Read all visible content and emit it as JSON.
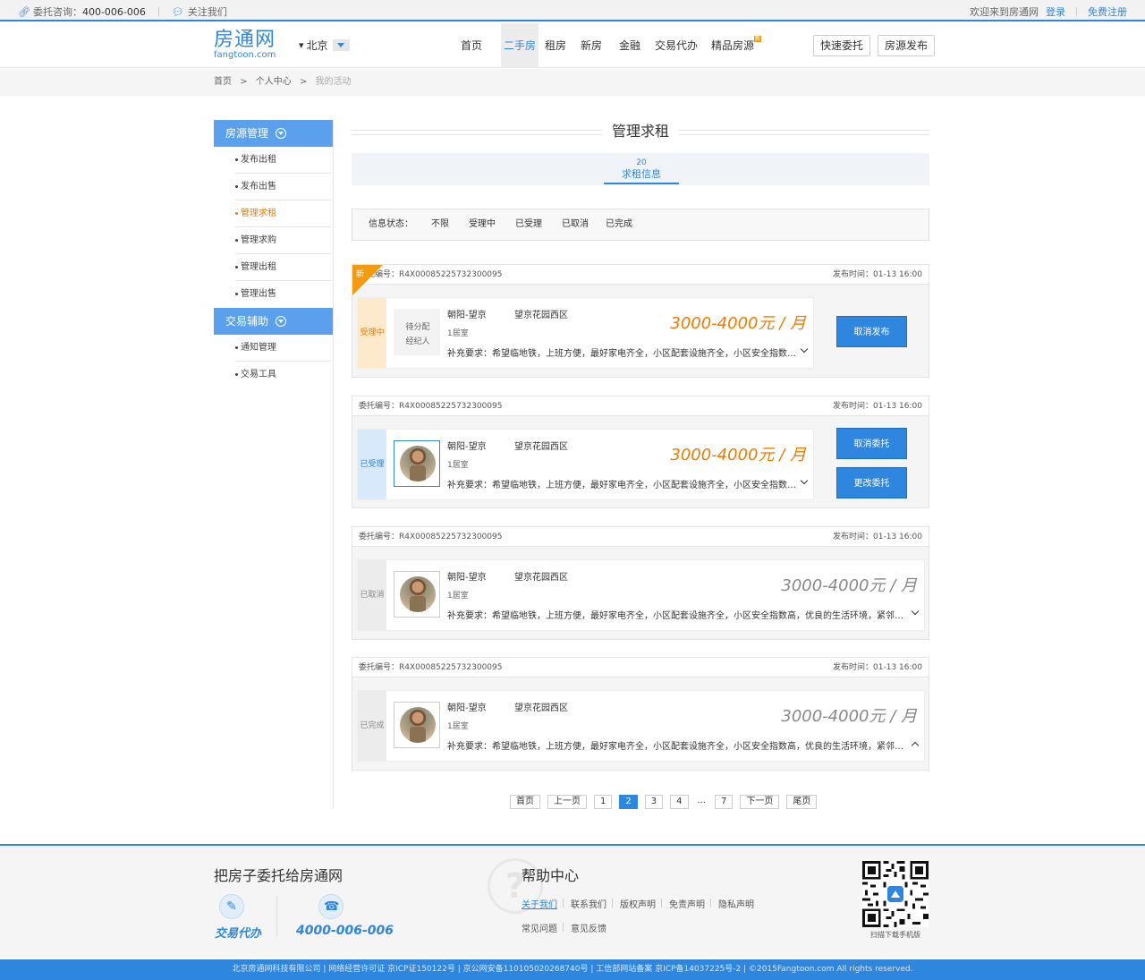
{
  "topbar": {
    "consult_label": "委托咨询：",
    "consult_phone": "400-006-006",
    "follow_label": "关注我们",
    "welcome": "欢迎来到房通网",
    "login": "登录",
    "register": "免费注册"
  },
  "header": {
    "logo_main": "房通网",
    "logo_sub": "fangtoon.com",
    "city": "北京",
    "nav": [
      "首页",
      "二手房",
      "租房",
      "新房",
      "金融",
      "交易代办",
      "精品房源"
    ],
    "nav_badge": "新",
    "active_nav": "二手房",
    "btn_quick": "快速委托",
    "btn_publish": "房源发布"
  },
  "breadcrumb": {
    "home": "首页",
    "center": "个人中心",
    "current": "我的活动",
    "sep": ">"
  },
  "sidebar": {
    "group1": "房源管理",
    "group1_items": [
      "发布出租",
      "发布出售",
      "管理求租",
      "管理求购",
      "管理出租",
      "管理出售"
    ],
    "group2": "交易辅助",
    "group2_items": [
      "通知管理",
      "交易工具"
    ],
    "active": "管理求租"
  },
  "main": {
    "title": "管理求租",
    "tab_count": "20",
    "tab_label": "求租信息",
    "filter_label": "信息状态：",
    "filters": [
      "不限",
      "受理中",
      "已受理",
      "已取消",
      "已完成"
    ]
  },
  "cards": [
    {
      "ribbon": "新",
      "code": "委托编号：R4X00085225732300095",
      "time": "发布时间：01-13 16:00",
      "status": "受理中",
      "agent_line1": "待分配",
      "agent_line2": "经纪人",
      "location": "朝阳-望京",
      "community": "望京花园西区",
      "rooms": "1居室",
      "desc": "补充要求：希望临地铁，上班方便，最好家电齐全，小区配套设施齐全，小区安全指数高，优...",
      "price": "3000-4000元 / 月",
      "buttons": [
        "取消发布"
      ]
    },
    {
      "code": "委托编号：R4X00085225732300095",
      "time": "发布时间：01-13 16:00",
      "status": "已受理",
      "location": "朝阳-望京",
      "community": "望京花园西区",
      "rooms": "1居室",
      "desc": "补充要求：希望临地铁，上班方便，最好家电齐全，小区配套设施齐全，小区安全指数高，优...",
      "price": "3000-4000元 / 月",
      "buttons": [
        "取消委托",
        "更改委托"
      ]
    },
    {
      "code": "委托编号：R4X00085225732300095",
      "time": "发布时间：01-13 16:00",
      "status": "已取消",
      "location": "朝阳-望京",
      "community": "望京花园西区",
      "rooms": "1居室",
      "desc": "补充要求：希望临地铁，上班方便，最好家电齐全，小区配套设施齐全，小区安全指数高，优良的生活环境，紧邻商业区，...",
      "price": "3000-4000元 / 月",
      "buttons": []
    },
    {
      "code": "委托编号：R4X00085225732300095",
      "time": "发布时间：01-13 16:00",
      "status": "已完成",
      "location": "朝阳-望京",
      "community": "望京花园西区",
      "rooms": "1居室",
      "desc": "补充要求：希望临地铁，上班方便，最好家电齐全，小区配套设施齐全，小区安全指数高，优良的生活环境，紧邻商业区，...",
      "price": "3000-4000元 / 月",
      "buttons": []
    }
  ],
  "pager": {
    "first": "首页",
    "prev": "上一页",
    "pages": [
      "1",
      "2",
      "3",
      "4",
      "...",
      "7"
    ],
    "current": "2",
    "next": "下一页",
    "last": "尾页"
  },
  "footer": {
    "slogan": "把房子委托给房通网",
    "service": "交易代办",
    "phone": "4000-006-006",
    "help_title": "帮助中心",
    "links_row1": [
      "关于我们",
      "联系我们",
      "版权声明",
      "免责声明",
      "隐私声明"
    ],
    "links_row2": [
      "常见问题",
      "意见反馈"
    ],
    "qr_caption": "扫描下载手机版",
    "copyright": "北京房通网科技有限公司 | 网络经营许可证 京ICP证150122号 | 京公网安备110105020268740号 | 工信部网站备案 京ICP备14037225号-2 | ©2015Fangtoon.com All rights reserved."
  },
  "colors": {
    "brand": "#2e86de",
    "accent": "#ee7a00",
    "ribbon": "#f29b12"
  }
}
